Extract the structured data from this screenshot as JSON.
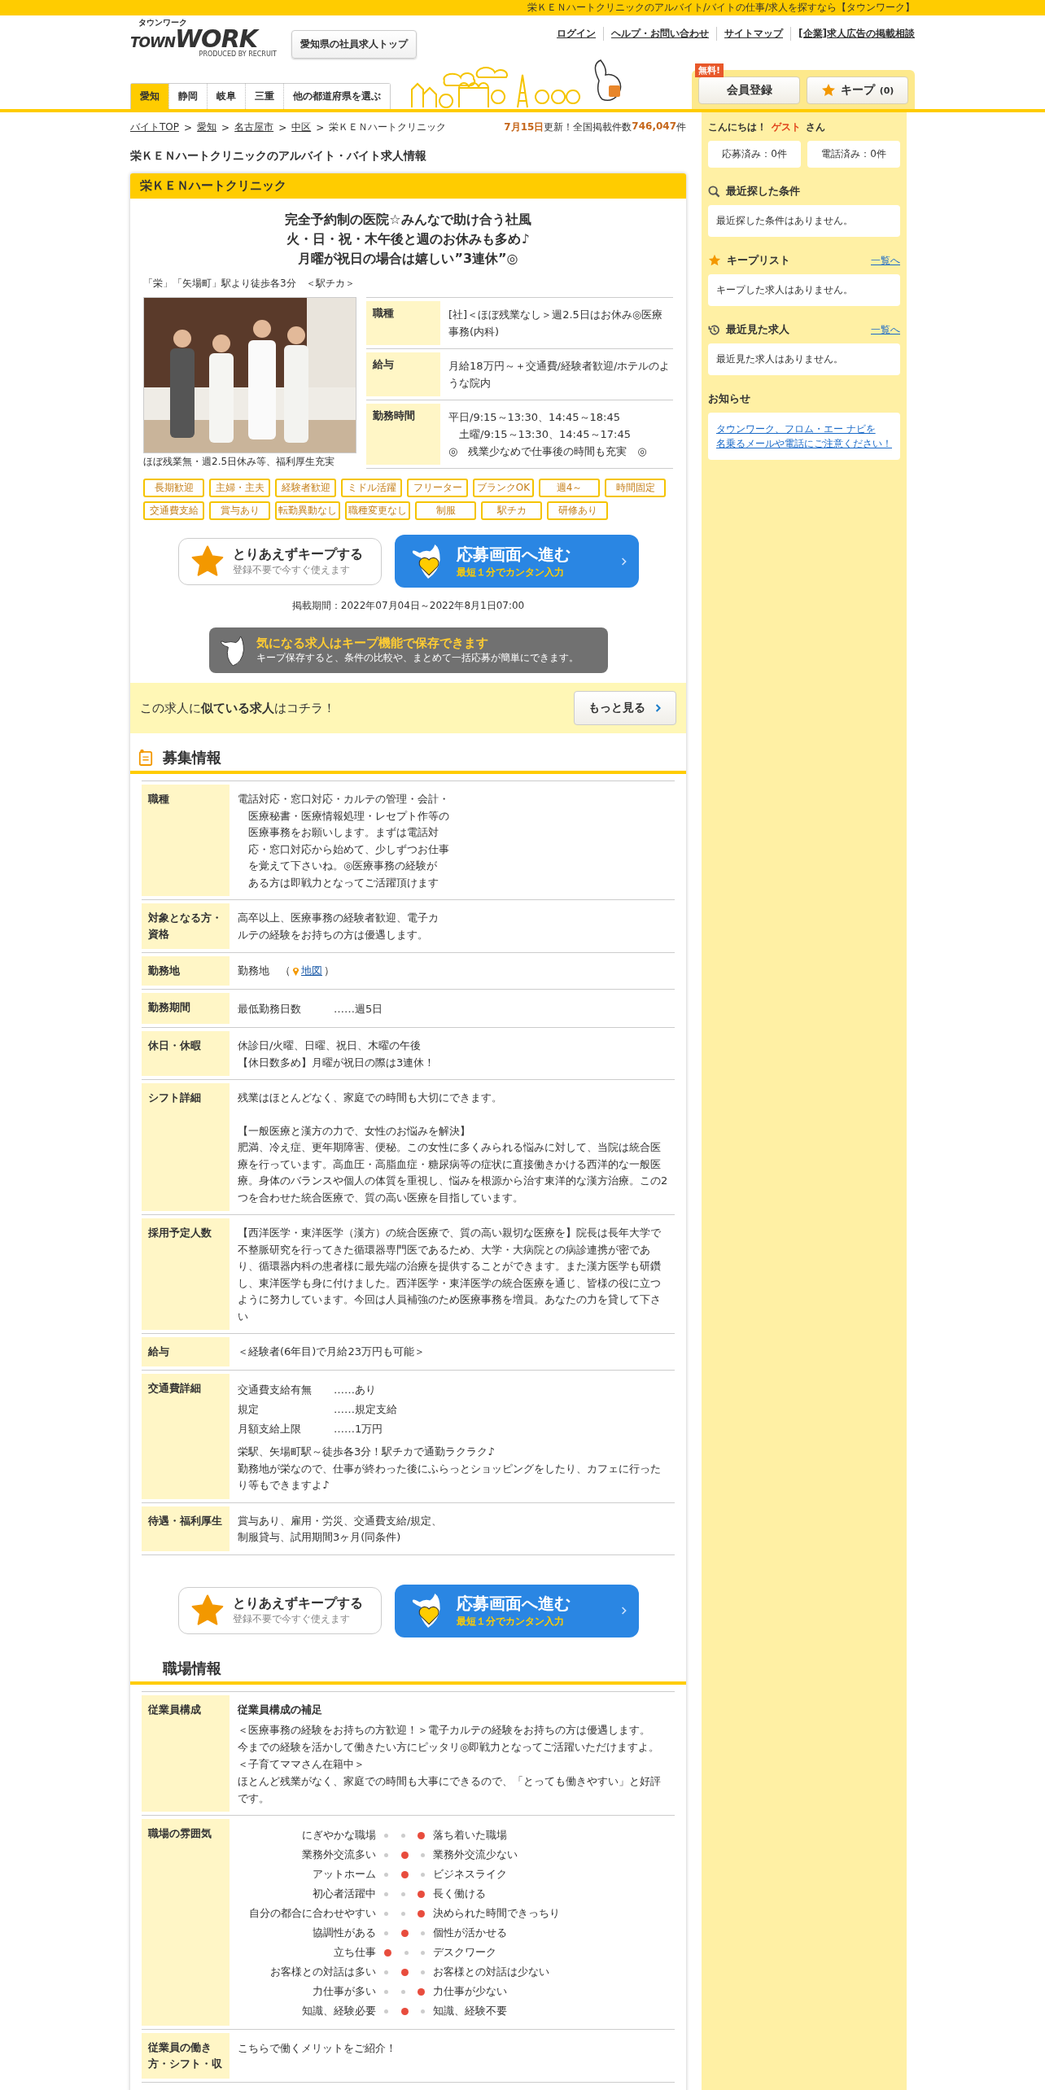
{
  "topbar": {
    "text": "栄ＫＥＮハートクリニックのアルバイト/バイトの仕事/求人を探すなら【タウンワーク】"
  },
  "header": {
    "logo_kana": "タウンワーク",
    "logo_town": "TOWN",
    "logo_work": "WORK",
    "logo_sub": "PRODUCED BY RECRUIT",
    "top_button": "愛知県の社員求人トップ",
    "nav": [
      "ログイン",
      "ヘルプ・お問い合わせ",
      "サイトマップ",
      "[企業]求人広告の掲載相談"
    ],
    "prefs": [
      {
        "label": "愛知",
        "selected": true
      },
      {
        "label": "静岡",
        "selected": false
      },
      {
        "label": "岐阜",
        "selected": false
      },
      {
        "label": "三重",
        "selected": false
      },
      {
        "label": "他の都道府県を選ぶ",
        "selected": false
      }
    ],
    "register": {
      "badge": "無料!",
      "label": "会員登録"
    },
    "keep": {
      "label": "キープ",
      "count": "(0)"
    }
  },
  "breadcrumb": [
    {
      "label": "バイトTOP",
      "link": true
    },
    {
      "sep": ">",
      "label": "愛知",
      "link": true
    },
    {
      "sep": ">",
      "label": "名古屋市",
      "link": true
    },
    {
      "sep": ">",
      "label": "中区",
      "link": true
    },
    {
      "sep": ">",
      "label": "栄ＫＥＮハートクリニック",
      "link": false
    }
  ],
  "update": {
    "date": "7月15日",
    "label": "更新！全国掲載件数",
    "count": "746,047",
    "unit": "件"
  },
  "page_title": "栄ＫＥＮハートクリニックのアルバイト・バイト求人情報",
  "job": {
    "name": "栄ＫＥＮハートクリニック",
    "catch": [
      "完全予約制の医院☆みんなで助け合う社風",
      "火・日・祝・木午後と週のお休みも多め♪",
      "月曜が祝日の場合は嬉しい”3連休”◎"
    ],
    "station": "「栄」「矢場町」駅より徒歩各3分　＜駅チカ＞",
    "photo": {
      "kind": "picture",
      "caption": "ほぼ残業無・週2.5日休み等、福利厚生充実"
    },
    "summary": [
      {
        "label": "職種",
        "lines": [
          "[社]＜ほぼ残業なし＞週2.5日はお休み◎医療事務(内科)"
        ]
      },
      {
        "label": "給与",
        "lines": [
          "月給18万円～＋交通費/経験者歓迎/ホテルのような院内"
        ]
      },
      {
        "label": "勤務時間",
        "lines": [
          "平日/9:15～13:30、14:45～18:45",
          "　土曜/9:15～13:30、14:45～17:45",
          "◎　残業少なめで仕事後の時間も充実　◎"
        ]
      }
    ],
    "tags": [
      "長期歓迎",
      "主婦・主夫",
      "経験者歓迎",
      "ミドル活躍",
      "フリーター",
      "ブランクOK",
      "週4～",
      "時間固定",
      "交通費支給",
      "賞与あり",
      "転勤異動なし",
      "職種変更なし",
      "制服",
      "駅チカ",
      "研修あり"
    ],
    "buttons_top": {
      "keep_title": "とりあえずキープする",
      "keep_sub": "登録不要で今すぐ使えます",
      "apply_title": "応募画面へ進む",
      "apply_sub": "最短１分でカンタン入力"
    },
    "period": "掲載期間：2022年07月04日～2022年8月1日07:00",
    "keep_banner": {
      "title": "気になる求人はキープ機能で保存できます",
      "text": "キープ保存すると、条件の比較や、まとめて一括応募が簡単にできます。"
    },
    "similar": {
      "text": "この求人に**似ている求人**はコチラ！",
      "button": "もっと見る"
    },
    "recruit": {
      "title": "募集情報",
      "rows": [
        {
          "label": "職種",
          "kind": "text",
          "paragraphs": [
            [
              "電話対応・窓口対応・カルテの管理・会計・",
              "　医療秘書・医療情報処理・レセプト作等の",
              "　医療事務をお願いします。まずは電話対",
              "　応・窓口対応から始めて、少しずつお仕事",
              "　を覚えて下さいね。◎医療事務の経験が",
              "　ある方は即戦力となってご活躍頂けます"
            ]
          ]
        },
        {
          "label": "対象となる方・資格",
          "kind": "text",
          "paragraphs": [
            [
              "高卒以上、医療事務の経験者歓迎、電子カ",
              "ルテの経験をお持ちの方は優遇します。"
            ]
          ]
        },
        {
          "label": "勤務地",
          "kind": "location",
          "text": "勤務地　（",
          "link": "地図",
          "suffix": "）"
        },
        {
          "label": "勤務期間",
          "kind": "pairs",
          "pairs": [
            {
              "key": "最低勤務日数",
              "value": "……週5日"
            }
          ]
        },
        {
          "label": "休日・休暇",
          "kind": "text",
          "paragraphs": [
            [
              "休診日/火曜、日曜、祝日、木曜の午後",
              "【休日数多め】月曜が祝日の際は3連休！"
            ]
          ]
        },
        {
          "label": "シフト詳細",
          "kind": "text",
          "paragraphs": [
            [
              "残業はほとんどなく、家庭での時間も大切にできます。"
            ],
            [
              "【一般医療と漢方の力で、女性のお悩みを解決】",
              "肥満、冷え症、更年期障害、便秘。この女性に多くみられる悩みに対して、当院は統合医療を行っています。高血圧・高脂血症・糖尿病等の症状に直接働きかける西洋的な一般医療。身体のバランスや個人の体質を重視し、悩みを根源から治す東洋的な漢方治療。この2つを合わせた統合医療で、質の高い医療を目指しています。"
            ]
          ]
        },
        {
          "label": "採用予定人数",
          "kind": "text",
          "paragraphs": [
            [
              "【西洋医学・東洋医学（漢方）の統合医療で、質の高い親切な医療を】院長は長年大学で不整脈研究を行ってきた循環器専門医であるため、大学・大病院との病診連携が密であり、循環器内科の患者様に最先端の治療を提供することができます。また漢方医学も研鑽し、東洋医学も身に付けました。西洋医学・東洋医学の統合医療を通じ、皆様の役に立つように努力しています。今回は人員補強のため医療事務を増員。あなたの力を貸して下さい"
            ]
          ]
        },
        {
          "label": "給与",
          "kind": "text",
          "paragraphs": [
            [
              "＜経験者(6年目)で月給23万円も可能＞"
            ]
          ]
        },
        {
          "label": "交通費詳細",
          "kind": "pairs",
          "pairs": [
            {
              "key": "交通費支給有無",
              "value": "……あり"
            },
            {
              "key": "規定",
              "value": "……規定支給"
            },
            {
              "key": "月額支給上限",
              "value": "……1万円"
            }
          ],
          "note": [
            "栄駅、矢場町駅～徒歩各3分！駅チカで通勤ラクラク♪",
            "勤務地が栄なので、仕事が終わった後にふらっとショッピングをしたり、カフェに行ったり等もできますよ♪"
          ]
        },
        {
          "label": "待遇・福利厚生",
          "kind": "text",
          "paragraphs": [
            [
              "賞与あり、雇用・労災、交通費支給/規定、",
              "制服貸与、試用期間3ヶ月(同条件)"
            ]
          ]
        }
      ]
    },
    "buttons_bottom": {
      "keep_title": "とりあえずキープする",
      "keep_sub": "登録不要で今すぐ使えます",
      "apply_title": "応募画面へ進む",
      "apply_sub": "最短１分でカンタン入力"
    },
    "workplace": {
      "title": "職場情報",
      "rows": [
        {
          "label": "従業員構成",
          "kind": "titled",
          "title": "従業員構成の補足",
          "paragraphs": [
            [
              "＜医療事務の経験をお持ちの方歓迎！＞電子カルテの経験をお持ちの方は優遇します。",
              "今までの経験を活かして働きたい方にピッタリ◎即戦力となってご活躍いただけますよ。",
              "＜子育てママさん在籍中＞",
              "ほとんど残業がなく、家庭での時間も大事にできるので、「とっても働きやすい」と好評です。"
            ]
          ]
        },
        {
          "label": "職場の雰囲気",
          "kind": "scale",
          "items": [
            {
              "left": "にぎやかな職場",
              "right": "落ち着いた職場",
              "level": 1
            },
            {
              "left": "業務外交流多い",
              "right": "業務外交流少ない",
              "level": 0.5
            },
            {
              "left": "アットホーム",
              "right": "ビジネスライク",
              "level": 0.5
            },
            {
              "left": "初心者活躍中",
              "right": "長く働ける",
              "level": 1
            },
            {
              "left": "自分の都合に合わせやすい",
              "right": "決められた時間できっちり",
              "level": 1
            },
            {
              "left": "協調性がある",
              "right": "個性が活かせる",
              "level": 0.5
            },
            {
              "left": "立ち仕事",
              "right": "デスクワーク",
              "level": 0
            },
            {
              "left": "お客様との対話は多い",
              "right": "お客様との対話は少ない",
              "level": 0.5
            },
            {
              "left": "力仕事が多い",
              "right": "力仕事が少ない",
              "level": 1
            },
            {
              "left": "知識、経験必要",
              "right": "知識、経験不要",
              "level": 0.5
            }
          ]
        },
        {
          "label": "従業員の働き方・シフト・収",
          "kind": "text",
          "paragraphs": [
            [
              "こちらで働くメリットをご紹介！"
            ]
          ]
        }
      ]
    }
  },
  "sidebar": {
    "greeting": "こんにちは！",
    "guest": "ゲスト",
    "suffix": "さん",
    "counts": [
      "応募済み：0件",
      "電話済み：0件"
    ],
    "sections": [
      {
        "title": "最近探した条件",
        "text": "最近探した条件はありません。"
      },
      {
        "title": "キープリスト",
        "link": "一覧へ",
        "text": "キープした求人はありません。"
      },
      {
        "title": "最近見た求人",
        "link": "一覧へ",
        "text": "最近見た求人はありません。"
      }
    ],
    "notice": {
      "title": "お知らせ",
      "links": [
        "タウンワーク、フロム・エー ナビを",
        "名乗るメールや電話にご注意ください！"
      ]
    }
  }
}
